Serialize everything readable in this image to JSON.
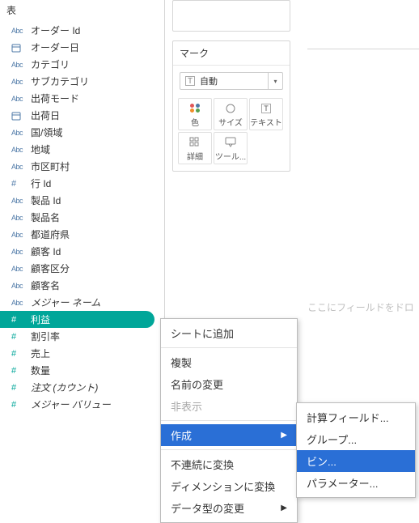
{
  "pane_header": "表",
  "fields": [
    {
      "icon": "Abc",
      "type": "dim",
      "label": "オーダー Id"
    },
    {
      "icon": "cal",
      "type": "dim",
      "label": "オーダー日"
    },
    {
      "icon": "Abc",
      "type": "dim",
      "label": "カテゴリ"
    },
    {
      "icon": "Abc",
      "type": "dim",
      "label": "サブカテゴリ"
    },
    {
      "icon": "Abc",
      "type": "dim",
      "label": "出荷モード"
    },
    {
      "icon": "cal",
      "type": "dim",
      "label": "出荷日"
    },
    {
      "icon": "Abc",
      "type": "dim",
      "label": "国/領域"
    },
    {
      "icon": "Abc",
      "type": "dim",
      "label": "地域"
    },
    {
      "icon": "Abc",
      "type": "dim",
      "label": "市区町村"
    },
    {
      "icon": "#",
      "type": "dim",
      "label": "行 Id"
    },
    {
      "icon": "Abc",
      "type": "dim",
      "label": "製品 Id"
    },
    {
      "icon": "Abc",
      "type": "dim",
      "label": "製品名"
    },
    {
      "icon": "Abc",
      "type": "dim",
      "label": "都道府県"
    },
    {
      "icon": "Abc",
      "type": "dim",
      "label": "顧客 Id"
    },
    {
      "icon": "Abc",
      "type": "dim",
      "label": "顧客区分"
    },
    {
      "icon": "Abc",
      "type": "dim",
      "label": "顧客名"
    },
    {
      "icon": "Abc",
      "type": "dim",
      "label": "メジャー ネーム",
      "italic": true
    },
    {
      "icon": "#",
      "type": "meas",
      "label": "利益",
      "selected": true
    },
    {
      "icon": "#",
      "type": "meas",
      "label": "割引率"
    },
    {
      "icon": "#",
      "type": "meas",
      "label": "売上"
    },
    {
      "icon": "#",
      "type": "meas",
      "label": "数量"
    },
    {
      "icon": "#",
      "type": "meas",
      "label": "注文 (カウント)",
      "italic": true
    },
    {
      "icon": "#",
      "type": "meas",
      "label": "メジャー バリュー",
      "italic": true
    }
  ],
  "marks": {
    "title": "マーク",
    "dropdown": "自動",
    "buttons": [
      {
        "label": "色",
        "icon": "color"
      },
      {
        "label": "サイズ",
        "icon": "size"
      },
      {
        "label": "テキスト",
        "icon": "text"
      },
      {
        "label": "詳細",
        "icon": "detail"
      },
      {
        "label": "ツール...",
        "icon": "tooltip"
      }
    ]
  },
  "canvas_hint": "ここにフィールドをドロ",
  "context_menu": {
    "add_to_sheet": "シートに追加",
    "duplicate": "複製",
    "rename": "名前の変更",
    "hide": "非表示",
    "create": "作成",
    "to_discrete": "不連続に変換",
    "to_dimension": "ディメンションに変換",
    "change_type": "データ型の変更"
  },
  "submenu": {
    "calculated_field": "計算フィールド...",
    "group": "グループ...",
    "bin": "ビン...",
    "parameter": "パラメーター..."
  }
}
